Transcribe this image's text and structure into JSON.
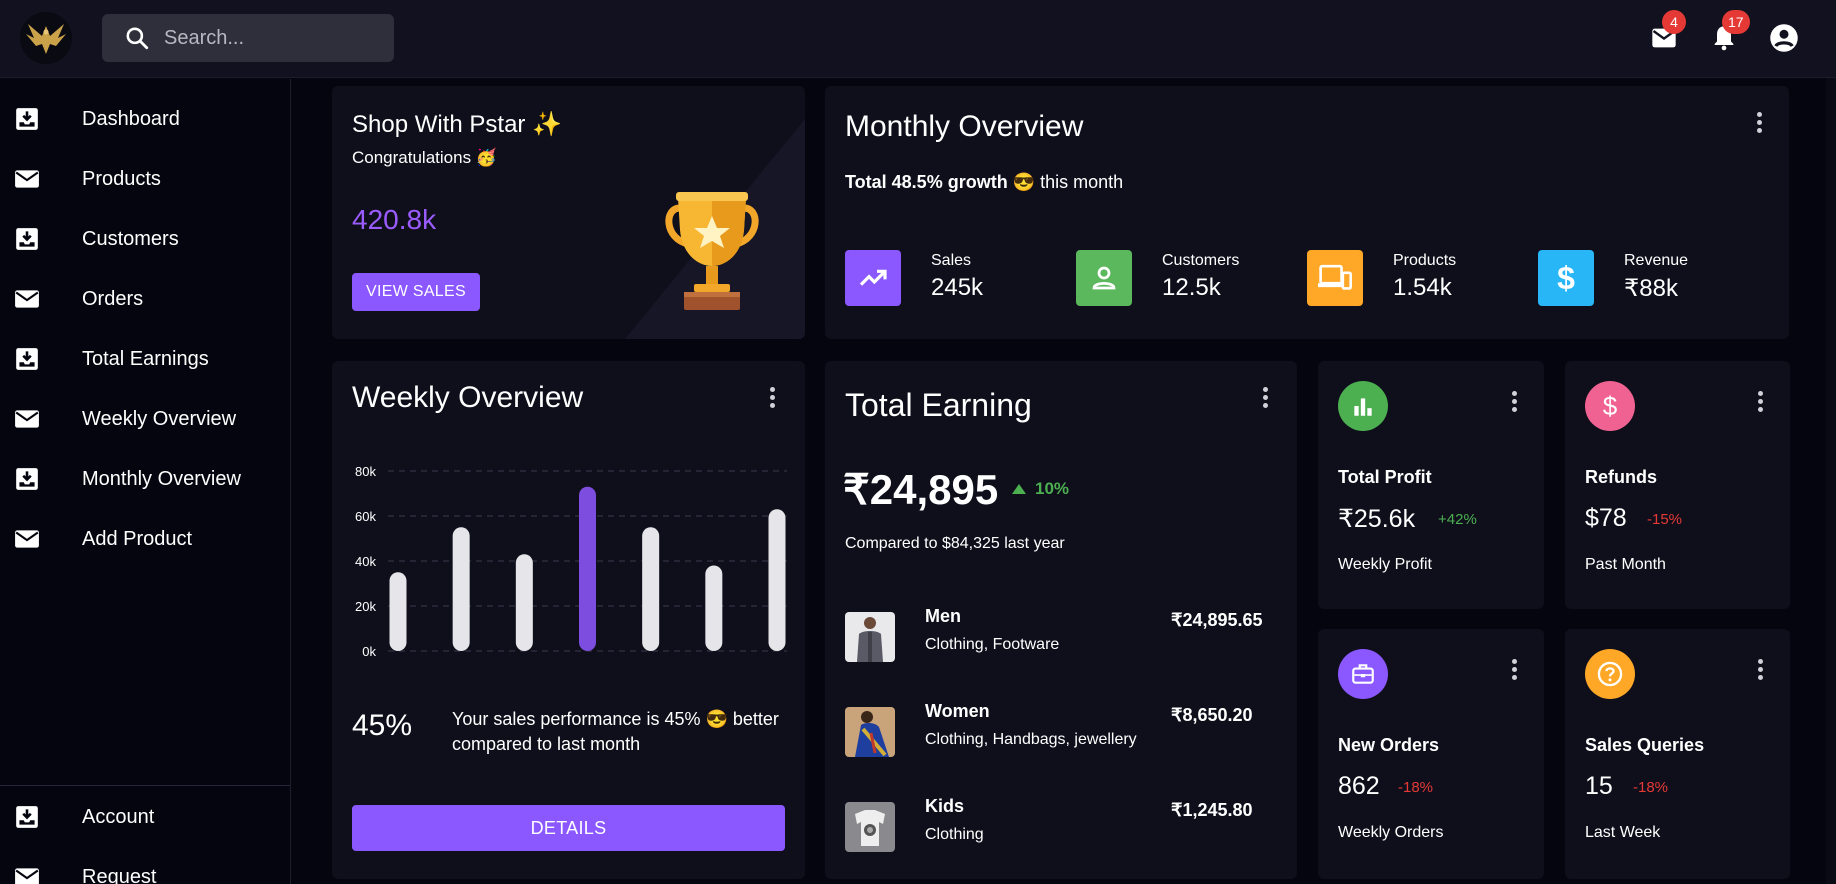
{
  "search": {
    "placeholder": "Search..."
  },
  "header": {
    "mail_badge": "4",
    "notifications_badge": "17"
  },
  "sidebar": {
    "items": [
      {
        "label": "Dashboard",
        "icon": "inbox-download-icon"
      },
      {
        "label": "Products",
        "icon": "mail-icon"
      },
      {
        "label": "Customers",
        "icon": "inbox-download-icon"
      },
      {
        "label": "Orders",
        "icon": "mail-icon"
      },
      {
        "label": "Total Earnings",
        "icon": "inbox-download-icon"
      },
      {
        "label": "Weekly Overview",
        "icon": "mail-icon"
      },
      {
        "label": "Monthly Overview",
        "icon": "inbox-download-icon"
      },
      {
        "label": "Add Product",
        "icon": "mail-icon"
      }
    ],
    "bottom_items": [
      {
        "label": "Account",
        "icon": "inbox-download-icon"
      },
      {
        "label": "Request",
        "icon": "mail-icon"
      }
    ]
  },
  "welcome": {
    "title": "Shop With Pstar ✨",
    "subtitle": "Congratulations 🥳",
    "value": "420.8k",
    "button": "VIEW SALES"
  },
  "monthly": {
    "title": "Monthly Overview",
    "growth_bold": "Total 48.5% growth",
    "growth_emoji": "😎",
    "growth_rest": "this month",
    "stats": [
      {
        "label": "Sales",
        "value": "245k",
        "color": "#8b57ff",
        "icon": "trending-up-icon"
      },
      {
        "label": "Customers",
        "value": "12.5k",
        "color": "#5cb85c",
        "icon": "person-icon"
      },
      {
        "label": "Products",
        "value": "1.54k",
        "color": "#ffa726",
        "icon": "devices-icon"
      },
      {
        "label": "Revenue",
        "value": "₹88k",
        "color": "#29b6f6",
        "icon": "dollar-icon"
      }
    ]
  },
  "weekly": {
    "title": "Weekly Overview",
    "percent": "45%",
    "text": "Your sales performance is 45% 😎 better compared to last month",
    "button": "DETAILS"
  },
  "chart_data": {
    "type": "bar",
    "categories": [
      "",
      "",
      "",
      "",
      "",
      "",
      ""
    ],
    "values": [
      35,
      55,
      43,
      73,
      55,
      38,
      63
    ],
    "highlight_index": 3,
    "ylim": [
      0,
      80
    ],
    "yticks": [
      "0k",
      "20k",
      "40k",
      "60k",
      "80k"
    ],
    "grid": true,
    "colors": {
      "bar": "#e6e6ea",
      "highlight": "#7c4dde"
    }
  },
  "earning": {
    "title": "Total Earning",
    "amount": "₹24,895",
    "change": "10%",
    "compare": "Compared to $84,325 last year",
    "rows": [
      {
        "name": "Men",
        "category": "Clothing, Footware",
        "price": "₹24,895.65"
      },
      {
        "name": "Women",
        "category": "Clothing, Handbags, jewellery",
        "price": "₹8,650.20"
      },
      {
        "name": "Kids",
        "category": "Clothing",
        "price": "₹1,245.80"
      }
    ]
  },
  "mini_cards": [
    {
      "title": "Total Profit",
      "value": "₹25.6k",
      "change": "+42%",
      "footer": "Weekly Profit",
      "color": "#4caf50",
      "icon": "bar-chart-icon"
    },
    {
      "title": "Refunds",
      "value": "$78",
      "change": "-15%",
      "footer": "Past Month",
      "color": "#f06292",
      "icon": "dollar-circle-icon"
    },
    {
      "title": "New Orders",
      "value": "862",
      "change": "-18%",
      "footer": "Weekly Orders",
      "color": "#8b57ff",
      "icon": "briefcase-icon"
    },
    {
      "title": "Sales Queries",
      "value": "15",
      "change": "-18%",
      "footer": "Last Week",
      "color": "#ffa726",
      "icon": "help-circle-icon"
    }
  ]
}
